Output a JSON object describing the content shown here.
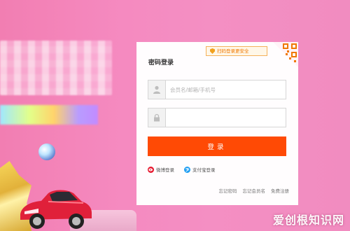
{
  "login": {
    "title": "密码登录",
    "qr_tip": "扫码登录更安全",
    "username_placeholder": "会员名/邮箱/手机号",
    "password_placeholder": "",
    "login_button": "登录",
    "third_party": [
      {
        "label": "微博登录",
        "icon": "weibo-icon"
      },
      {
        "label": "支付宝登录",
        "icon": "alipay-icon"
      }
    ],
    "links": [
      "忘记密码",
      "忘记会员名",
      "免费注册"
    ]
  },
  "colors": {
    "accent": "#ff4a05",
    "background": "#f48fc3",
    "qr_tip": "#f07800"
  },
  "watermark": "爱创根知识网"
}
